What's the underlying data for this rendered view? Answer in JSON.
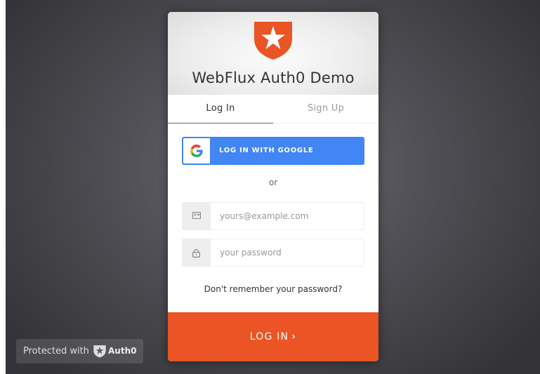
{
  "app": {
    "title": "WebFlux Auth0 Demo",
    "logo_icon": "auth0-shield-star-icon",
    "accent_color": "#eb5424"
  },
  "tabs": [
    {
      "label": "Log In",
      "active": true
    },
    {
      "label": "Sign Up",
      "active": false
    }
  ],
  "social": {
    "google_label": "LOG IN WITH GOOGLE",
    "google_icon": "google-g-icon",
    "button_color": "#4285f4"
  },
  "separator": "or",
  "form": {
    "email": {
      "placeholder": "yours@example.com",
      "value": "",
      "icon": "envelope-icon"
    },
    "password": {
      "placeholder": "your password",
      "value": "",
      "icon": "lock-icon"
    },
    "forgot_label": "Don't remember your password?"
  },
  "submit": {
    "label": "LOG IN",
    "icon": "chevron-right-icon"
  },
  "badge": {
    "text": "Protected with",
    "brand": "Auth0",
    "icon": "auth0-shield-icon"
  }
}
